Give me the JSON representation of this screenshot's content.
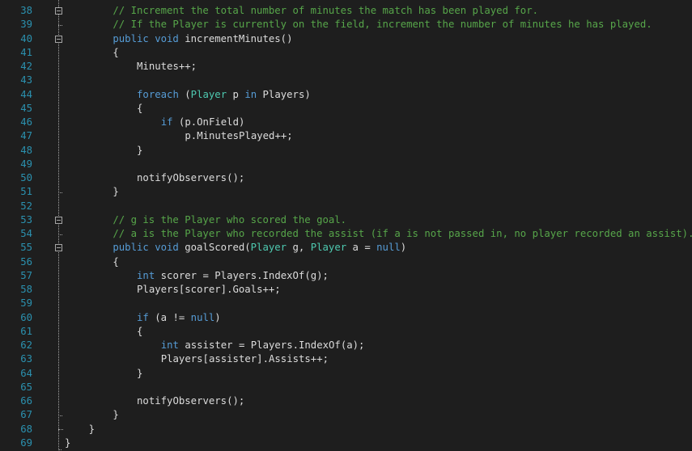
{
  "editor": {
    "colors": {
      "background": "#1e1e1e",
      "line_number": "#2b91af",
      "comment": "#57a64a",
      "keyword": "#569cd6",
      "type": "#4ec9b0",
      "text": "#dcdcdc"
    },
    "lines": [
      {
        "n": "38",
        "indent": 8,
        "fold": true,
        "tokens": [
          {
            "k": "comment",
            "t": "// Increment the total number of minutes the match has been played for."
          }
        ]
      },
      {
        "n": "39",
        "indent": 8,
        "fold": false,
        "tokens": [
          {
            "k": "comment",
            "t": "// If the Player is currently on the field, increment the number of minutes he has played."
          }
        ]
      },
      {
        "n": "40",
        "indent": 8,
        "fold": true,
        "tokens": [
          {
            "k": "kw",
            "t": "public"
          },
          {
            "k": "text",
            "t": " "
          },
          {
            "k": "kw",
            "t": "void"
          },
          {
            "k": "text",
            "t": " incrementMinutes()"
          }
        ]
      },
      {
        "n": "41",
        "indent": 8,
        "fold": false,
        "tokens": [
          {
            "k": "text",
            "t": "{"
          }
        ]
      },
      {
        "n": "42",
        "indent": 12,
        "fold": false,
        "tokens": [
          {
            "k": "text",
            "t": "Minutes++;"
          }
        ]
      },
      {
        "n": "43",
        "indent": 0,
        "fold": false,
        "tokens": []
      },
      {
        "n": "44",
        "indent": 12,
        "fold": false,
        "tokens": [
          {
            "k": "kw",
            "t": "foreach"
          },
          {
            "k": "text",
            "t": " ("
          },
          {
            "k": "type",
            "t": "Player"
          },
          {
            "k": "text",
            "t": " p "
          },
          {
            "k": "kw",
            "t": "in"
          },
          {
            "k": "text",
            "t": " Players)"
          }
        ]
      },
      {
        "n": "45",
        "indent": 12,
        "fold": false,
        "tokens": [
          {
            "k": "text",
            "t": "{"
          }
        ]
      },
      {
        "n": "46",
        "indent": 16,
        "fold": false,
        "tokens": [
          {
            "k": "kw",
            "t": "if"
          },
          {
            "k": "text",
            "t": " (p.OnField)"
          }
        ]
      },
      {
        "n": "47",
        "indent": 20,
        "fold": false,
        "tokens": [
          {
            "k": "text",
            "t": "p.MinutesPlayed++;"
          }
        ]
      },
      {
        "n": "48",
        "indent": 12,
        "fold": false,
        "tokens": [
          {
            "k": "text",
            "t": "}"
          }
        ]
      },
      {
        "n": "49",
        "indent": 0,
        "fold": false,
        "tokens": []
      },
      {
        "n": "50",
        "indent": 12,
        "fold": false,
        "tokens": [
          {
            "k": "text",
            "t": "notifyObservers();"
          }
        ]
      },
      {
        "n": "51",
        "indent": 8,
        "fold": false,
        "tokens": [
          {
            "k": "text",
            "t": "}"
          }
        ]
      },
      {
        "n": "52",
        "indent": 0,
        "fold": false,
        "tokens": []
      },
      {
        "n": "53",
        "indent": 8,
        "fold": true,
        "tokens": [
          {
            "k": "comment",
            "t": "// g is the Player who scored the goal."
          }
        ]
      },
      {
        "n": "54",
        "indent": 8,
        "fold": false,
        "tokens": [
          {
            "k": "comment",
            "t": "// a is the Player who recorded the assist (if a is not passed in, no player recorded an assist)."
          }
        ]
      },
      {
        "n": "55",
        "indent": 8,
        "fold": true,
        "tokens": [
          {
            "k": "kw",
            "t": "public"
          },
          {
            "k": "text",
            "t": " "
          },
          {
            "k": "kw",
            "t": "void"
          },
          {
            "k": "text",
            "t": " goalScored("
          },
          {
            "k": "type",
            "t": "Player"
          },
          {
            "k": "text",
            "t": " g, "
          },
          {
            "k": "type",
            "t": "Player"
          },
          {
            "k": "text",
            "t": " a = "
          },
          {
            "k": "kw",
            "t": "null"
          },
          {
            "k": "text",
            "t": ")"
          }
        ]
      },
      {
        "n": "56",
        "indent": 8,
        "fold": false,
        "tokens": [
          {
            "k": "text",
            "t": "{"
          }
        ]
      },
      {
        "n": "57",
        "indent": 12,
        "fold": false,
        "tokens": [
          {
            "k": "kw",
            "t": "int"
          },
          {
            "k": "text",
            "t": " scorer = Players.IndexOf(g);"
          }
        ]
      },
      {
        "n": "58",
        "indent": 12,
        "fold": false,
        "tokens": [
          {
            "k": "text",
            "t": "Players[scorer].Goals++;"
          }
        ]
      },
      {
        "n": "59",
        "indent": 0,
        "fold": false,
        "tokens": []
      },
      {
        "n": "60",
        "indent": 12,
        "fold": false,
        "tokens": [
          {
            "k": "kw",
            "t": "if"
          },
          {
            "k": "text",
            "t": " (a != "
          },
          {
            "k": "kw",
            "t": "null"
          },
          {
            "k": "text",
            "t": ")"
          }
        ]
      },
      {
        "n": "61",
        "indent": 12,
        "fold": false,
        "tokens": [
          {
            "k": "text",
            "t": "{"
          }
        ]
      },
      {
        "n": "62",
        "indent": 16,
        "fold": false,
        "tokens": [
          {
            "k": "kw",
            "t": "int"
          },
          {
            "k": "text",
            "t": " assister = Players.IndexOf(a);"
          }
        ]
      },
      {
        "n": "63",
        "indent": 16,
        "fold": false,
        "tokens": [
          {
            "k": "text",
            "t": "Players[assister].Assists++;"
          }
        ]
      },
      {
        "n": "64",
        "indent": 12,
        "fold": false,
        "tokens": [
          {
            "k": "text",
            "t": "}"
          }
        ]
      },
      {
        "n": "65",
        "indent": 0,
        "fold": false,
        "tokens": []
      },
      {
        "n": "66",
        "indent": 12,
        "fold": false,
        "tokens": [
          {
            "k": "text",
            "t": "notifyObservers();"
          }
        ]
      },
      {
        "n": "67",
        "indent": 8,
        "fold": false,
        "tokens": [
          {
            "k": "text",
            "t": "}"
          }
        ]
      },
      {
        "n": "68",
        "indent": 4,
        "fold": false,
        "tokens": [
          {
            "k": "text",
            "t": "}"
          }
        ]
      },
      {
        "n": "69",
        "indent": 0,
        "fold": false,
        "tokens": [
          {
            "k": "text",
            "t": "}"
          }
        ]
      }
    ]
  }
}
